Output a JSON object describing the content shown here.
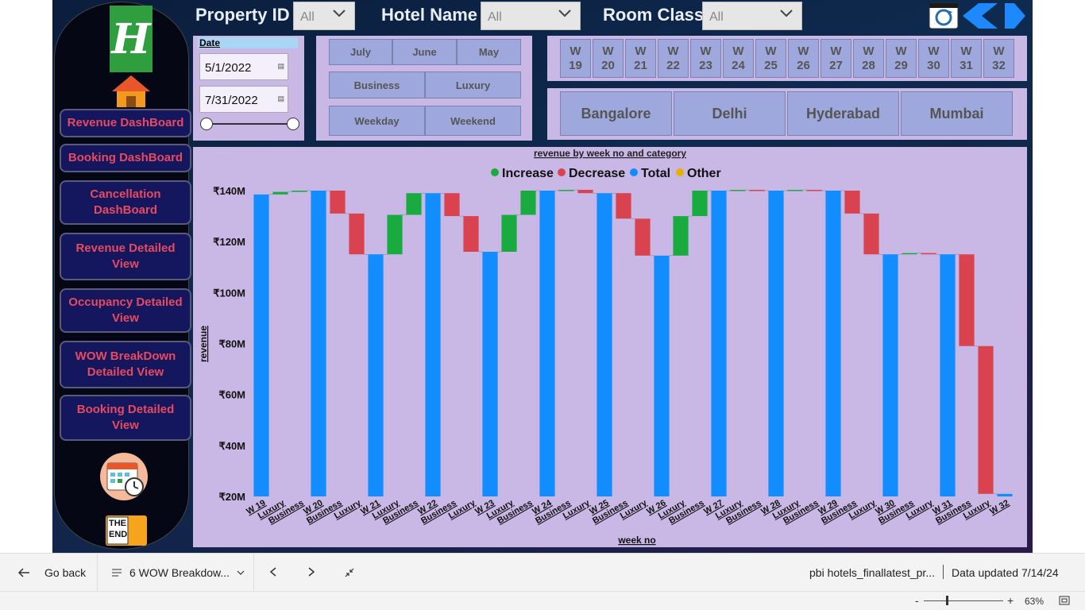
{
  "filters": {
    "property_label": "Property ID",
    "property_value": "All",
    "hotel_label": "Hotel Name",
    "hotel_value": "All",
    "room_label": "Room Class",
    "room_value": "All"
  },
  "nav": {
    "items": [
      "Revenue DashBoard",
      "Booking DashBoard",
      "Cancellation DashBoard",
      "Revenue Detailed View",
      "Occupancy Detailed View",
      "WOW BreakDown Detailed View",
      "Booking Detailed View"
    ],
    "end_label_1": "THE",
    "end_label_2": "END"
  },
  "date_slicer": {
    "label": "Date",
    "start": "5/1/2022",
    "end": "7/31/2022"
  },
  "month_slicer": [
    "July",
    "June",
    "May"
  ],
  "category_slicer": [
    "Business",
    "Luxury"
  ],
  "daytype_slicer": [
    "Weekday",
    "Weekend"
  ],
  "week_slicer": [
    {
      "w": "W",
      "n": "19"
    },
    {
      "w": "W",
      "n": "20"
    },
    {
      "w": "W",
      "n": "21"
    },
    {
      "w": "W",
      "n": "22"
    },
    {
      "w": "W",
      "n": "23"
    },
    {
      "w": "W",
      "n": "24"
    },
    {
      "w": "W",
      "n": "25"
    },
    {
      "w": "W",
      "n": "26"
    },
    {
      "w": "W",
      "n": "27"
    },
    {
      "w": "W",
      "n": "28"
    },
    {
      "w": "W",
      "n": "29"
    },
    {
      "w": "W",
      "n": "30"
    },
    {
      "w": "W",
      "n": "31"
    },
    {
      "w": "W",
      "n": "32"
    }
  ],
  "city_slicer": [
    "Bangalore",
    "Delhi",
    "Hyderabad",
    "Mumbai"
  ],
  "colors": {
    "increase": "#1aab40",
    "decrease": "#d9434f",
    "total": "#118dff",
    "other": "#e6b000"
  },
  "chart_data": {
    "type": "waterfall",
    "title": "revenue by week no and category",
    "xlabel": "week no",
    "ylabel": "revenue",
    "legend": [
      "Increase",
      "Decrease",
      "Total",
      "Other"
    ],
    "legend_position": "top-center",
    "ylim": [
      20,
      142
    ],
    "y_unit": "M",
    "yticks": [
      "₹140M",
      "₹120M",
      "₹100M",
      "₹80M",
      "₹60M",
      "₹40M",
      "₹20M"
    ],
    "ytick_values": [
      140,
      120,
      100,
      80,
      60,
      40,
      20
    ],
    "bars": [
      {
        "label": "W 19",
        "kind": "total",
        "start": 20,
        "end": 138.5
      },
      {
        "label": "Luxury",
        "kind": "increase",
        "start": 138.5,
        "end": 139.5
      },
      {
        "label": "Business",
        "kind": "increase",
        "start": 139.5,
        "end": 140
      },
      {
        "label": "W 20",
        "kind": "total",
        "start": 20,
        "end": 140
      },
      {
        "label": "Business",
        "kind": "decrease",
        "start": 140,
        "end": 131
      },
      {
        "label": "Luxury",
        "kind": "decrease",
        "start": 131,
        "end": 115
      },
      {
        "label": "W 21",
        "kind": "total",
        "start": 20,
        "end": 115
      },
      {
        "label": "Luxury",
        "kind": "increase",
        "start": 115,
        "end": 130.5
      },
      {
        "label": "Business",
        "kind": "increase",
        "start": 130.5,
        "end": 139
      },
      {
        "label": "W 22",
        "kind": "total",
        "start": 20,
        "end": 139
      },
      {
        "label": "Business",
        "kind": "decrease",
        "start": 139,
        "end": 130
      },
      {
        "label": "Luxury",
        "kind": "decrease",
        "start": 130,
        "end": 116
      },
      {
        "label": "W 23",
        "kind": "total",
        "start": 20,
        "end": 116
      },
      {
        "label": "Luxury",
        "kind": "increase",
        "start": 116,
        "end": 130.5
      },
      {
        "label": "Business",
        "kind": "increase",
        "start": 130.5,
        "end": 140
      },
      {
        "label": "W 24",
        "kind": "total",
        "start": 20,
        "end": 140
      },
      {
        "label": "Business",
        "kind": "increase",
        "start": 140,
        "end": 140.3
      },
      {
        "label": "Luxury",
        "kind": "decrease",
        "start": 140.3,
        "end": 139
      },
      {
        "label": "W 25",
        "kind": "total",
        "start": 20,
        "end": 139
      },
      {
        "label": "Business",
        "kind": "decrease",
        "start": 139,
        "end": 129
      },
      {
        "label": "Luxury",
        "kind": "decrease",
        "start": 129,
        "end": 114.5
      },
      {
        "label": "W 26",
        "kind": "total",
        "start": 20,
        "end": 114.5
      },
      {
        "label": "Luxury",
        "kind": "increase",
        "start": 114.5,
        "end": 130
      },
      {
        "label": "Business",
        "kind": "increase",
        "start": 130,
        "end": 140
      },
      {
        "label": "W 27",
        "kind": "total",
        "start": 20,
        "end": 140
      },
      {
        "label": "Luxury",
        "kind": "increase",
        "start": 140,
        "end": 140.3
      },
      {
        "label": "Business",
        "kind": "decrease",
        "start": 140.3,
        "end": 140
      },
      {
        "label": "W 28",
        "kind": "total",
        "start": 20,
        "end": 140
      },
      {
        "label": "Luxury",
        "kind": "increase",
        "start": 140,
        "end": 140.3
      },
      {
        "label": "Business",
        "kind": "decrease",
        "start": 140.3,
        "end": 140
      },
      {
        "label": "W 29",
        "kind": "total",
        "start": 20,
        "end": 140
      },
      {
        "label": "Business",
        "kind": "decrease",
        "start": 140,
        "end": 131
      },
      {
        "label": "Luxury",
        "kind": "decrease",
        "start": 131,
        "end": 115
      },
      {
        "label": "W 30",
        "kind": "total",
        "start": 20,
        "end": 115
      },
      {
        "label": "Business",
        "kind": "increase",
        "start": 115,
        "end": 115.5
      },
      {
        "label": "Luxury",
        "kind": "decrease",
        "start": 115.5,
        "end": 115
      },
      {
        "label": "W 31",
        "kind": "total",
        "start": 20,
        "end": 115
      },
      {
        "label": "Business",
        "kind": "decrease",
        "start": 115,
        "end": 79
      },
      {
        "label": "Luxury",
        "kind": "decrease",
        "start": 79,
        "end": 21
      },
      {
        "label": "W 32",
        "kind": "total",
        "start": 20,
        "end": 21
      }
    ]
  },
  "bottombar": {
    "go_back": "Go back",
    "page": "6 WOW Breakdow...",
    "report": "pbi hotels_finallatest_pr...",
    "updated": "Data updated 7/14/24",
    "zoom": "63%",
    "zoom_minus": "-",
    "zoom_plus": "+"
  }
}
